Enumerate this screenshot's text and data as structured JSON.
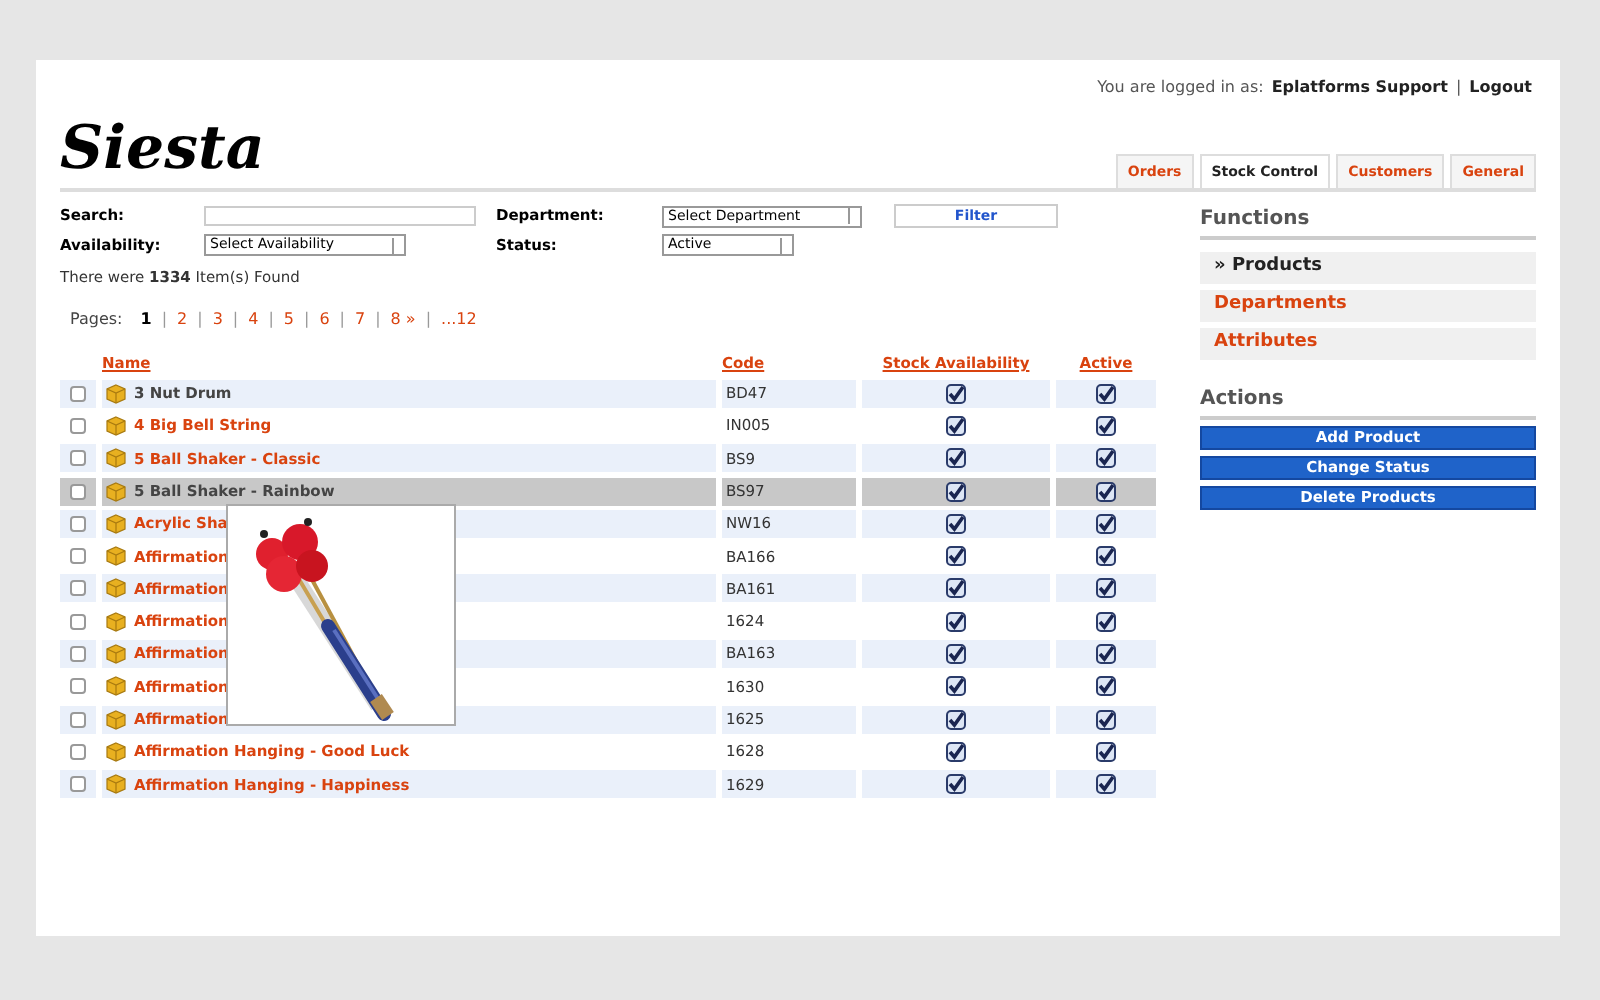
{
  "header": {
    "logo": "Siesta",
    "login_label": "You are logged in as:",
    "user": "Eplatforms Support",
    "separator": "|",
    "logout": "Logout"
  },
  "tabs": [
    {
      "label": "Orders",
      "selected": false
    },
    {
      "label": "Stock Control",
      "selected": true
    },
    {
      "label": "Customers",
      "selected": false
    },
    {
      "label": "General",
      "selected": false
    }
  ],
  "filters": {
    "search_label": "Search:",
    "department_label": "Department:",
    "department_value": "Select Department",
    "filter_button": "Filter",
    "availability_label": "Availability:",
    "availability_value": "Select Availability",
    "status_label": "Status:",
    "status_value": "Active"
  },
  "result_summary": "There were **1334** Item(s) Found",
  "pagination": {
    "label": "Pages:",
    "separator": "|",
    "pages": [
      {
        "label": "1",
        "selected": true
      },
      {
        "label": "2",
        "selected": false
      },
      {
        "label": "3",
        "selected": false
      },
      {
        "label": "4",
        "selected": false
      },
      {
        "label": "5",
        "selected": false
      },
      {
        "label": "6",
        "selected": false
      },
      {
        "label": "7",
        "selected": false
      },
      {
        "label": "8 »",
        "selected": false
      },
      {
        "label": "...12",
        "selected": false
      }
    ]
  },
  "table": {
    "columns": [
      "Name",
      "Code",
      "Stock Availability",
      "Active"
    ],
    "rows": [
      {
        "name": "3 Nut Drum",
        "code": "BD47",
        "checked": false,
        "selected": false,
        "visited": true,
        "stock": true,
        "active": true
      },
      {
        "name": "4 Big Bell String",
        "code": "IN005",
        "checked": false,
        "selected": false,
        "visited": false,
        "stock": true,
        "active": true
      },
      {
        "name": "5 Ball Shaker - Classic",
        "code": "BS9",
        "checked": false,
        "selected": false,
        "visited": false,
        "stock": true,
        "active": true
      },
      {
        "name": "5 Ball Shaker - Rainbow",
        "code": "BS97",
        "checked": false,
        "selected": true,
        "visited": false,
        "stock": true,
        "active": true
      },
      {
        "name": "Acrylic Sha",
        "code": "NW16",
        "checked": false,
        "selected": false,
        "visited": false,
        "stock": true,
        "active": true
      },
      {
        "name": "Affirmation",
        "code": "BA166",
        "checked": false,
        "selected": false,
        "visited": false,
        "stock": true,
        "active": true
      },
      {
        "name": "Affirmation",
        "code": "BA161",
        "checked": false,
        "selected": false,
        "visited": false,
        "stock": true,
        "active": true
      },
      {
        "name": "Affirmation",
        "code": "1624",
        "checked": false,
        "selected": false,
        "visited": false,
        "stock": true,
        "active": true
      },
      {
        "name": "Affirmation",
        "code": "BA163",
        "checked": false,
        "selected": false,
        "visited": false,
        "stock": true,
        "active": true
      },
      {
        "name": "Affirmation",
        "code": "1630",
        "checked": false,
        "selected": false,
        "visited": false,
        "stock": true,
        "active": true
      },
      {
        "name": "Affirmation",
        "code": "1625",
        "checked": false,
        "selected": false,
        "visited": false,
        "stock": true,
        "active": true
      },
      {
        "name": "Affirmation Hanging - Good Luck",
        "code": "1628",
        "checked": false,
        "selected": false,
        "visited": false,
        "stock": true,
        "active": true
      },
      {
        "name": "Affirmation Hanging - Happiness",
        "code": "1629",
        "checked": false,
        "selected": false,
        "visited": false,
        "stock": true,
        "active": true
      }
    ]
  },
  "functions": {
    "title": "Functions",
    "items": [
      {
        "label": "» Products",
        "selected": true
      },
      {
        "label": "Departments",
        "selected": false
      },
      {
        "label": "Attributes",
        "selected": false
      }
    ]
  },
  "actions": {
    "title": "Actions",
    "buttons": [
      "Add Product",
      "Change Status",
      "Delete Products"
    ]
  }
}
